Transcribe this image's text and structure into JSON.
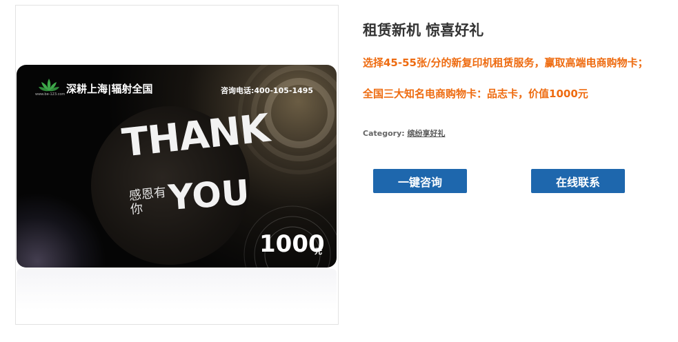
{
  "product": {
    "title": "租赁新机 惊喜好礼",
    "promo_line1": "选择45-55张/分的新复印机租赁服务，赢取高端电商购物卡；",
    "promo_line2": "全国三大知名电商购物卡：品志卡，价值1000元",
    "category_label": "Category:",
    "category_value": "缤纷享好礼"
  },
  "buttons": {
    "consult": "一键咨询",
    "contact": "在线联系"
  },
  "card": {
    "slogan": "深耕上海|辐射全国",
    "phone": "咨询电话:400-105-1495",
    "thank": "THANK",
    "you": "YOU",
    "gan_en": "感恩有你",
    "amount": "1000",
    "unit": "元",
    "logo_sub": "www.be-123.com"
  },
  "colors": {
    "accent_orange": "#ee6b10",
    "button_blue": "#1e67ad",
    "title_gray": "#333333"
  }
}
